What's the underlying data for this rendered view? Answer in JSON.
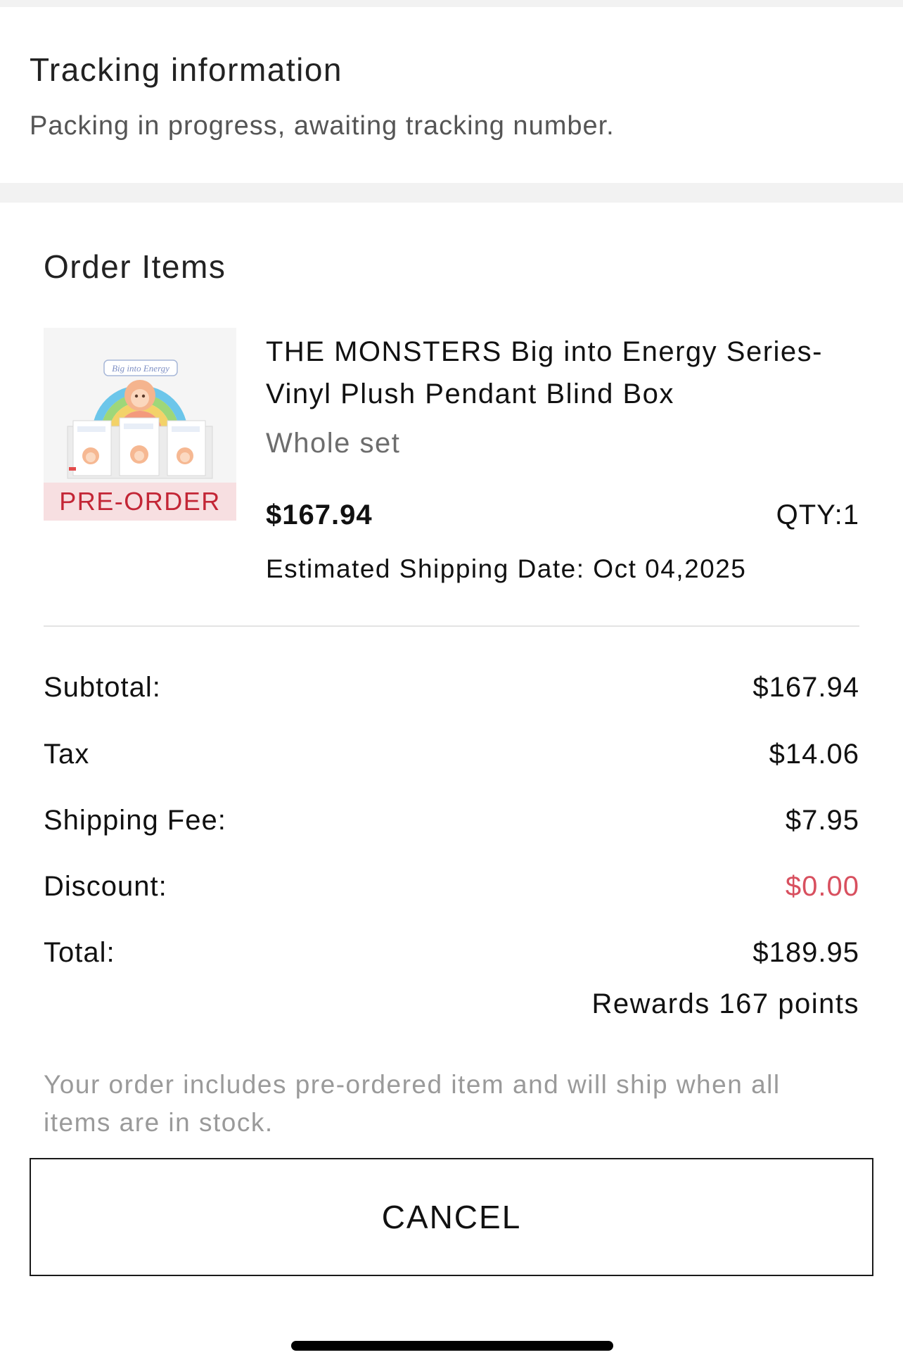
{
  "tracking": {
    "title": "Tracking information",
    "status": "Packing in progress, awaiting tracking number."
  },
  "order_items": {
    "title": "Order Items",
    "items": [
      {
        "name": "THE MONSTERS Big into Energy Series-Vinyl Plush Pendant Blind Box",
        "variant": "Whole set",
        "price": "$167.94",
        "qty": "QTY:1",
        "badge": "PRE-ORDER",
        "estimated_shipping": "Estimated Shipping Date: Oct 04,2025",
        "image_logo_text": "Big into Energy"
      }
    ]
  },
  "summary": {
    "subtotal_label": "Subtotal:",
    "subtotal_value": "$167.94",
    "tax_label": "Tax",
    "tax_value": "$14.06",
    "shipping_label": "Shipping Fee:",
    "shipping_value": "$7.95",
    "discount_label": "Discount:",
    "discount_value": "$0.00",
    "total_label": "Total:",
    "total_value": "$189.95",
    "rewards": "Rewards 167 points"
  },
  "note": "Your order includes pre-ordered item and will ship when all items are in stock.",
  "actions": {
    "cancel_label": "CANCEL"
  },
  "colors": {
    "badge_text": "#c32636",
    "badge_bg": "#f7dfe1",
    "discount": "#d8505f",
    "section_gap": "#f2f2f2"
  }
}
